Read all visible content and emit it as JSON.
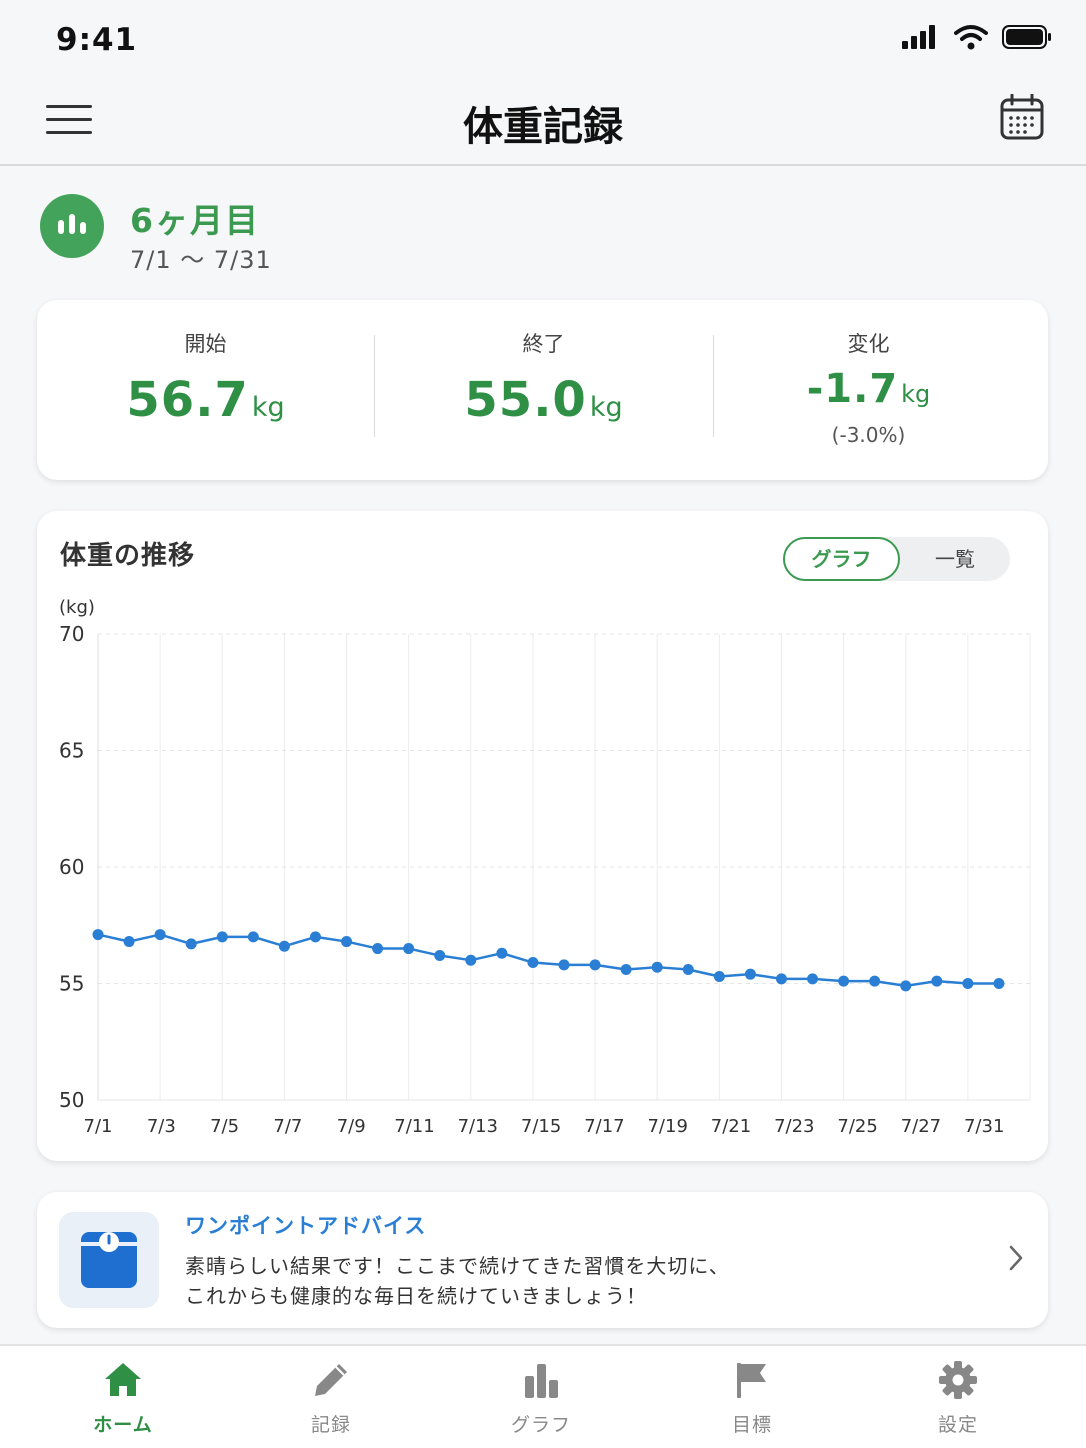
{
  "status_bar": {
    "time": "9:41"
  },
  "nav": {
    "title": "体重記録"
  },
  "period": {
    "title": "6ヶ月目",
    "range": "7/1 〜 7/31"
  },
  "summary": {
    "start": {
      "label": "開始",
      "value": "56.7",
      "unit": "kg"
    },
    "end": {
      "label": "終了",
      "value": "55.0",
      "unit": "kg"
    },
    "change": {
      "label": "変化",
      "value": "-1.7",
      "unit": "kg",
      "percent": "(-3.0%)"
    }
  },
  "chart_section": {
    "title": "体重の推移",
    "toggle_graph": "グラフ",
    "toggle_list": "一覧"
  },
  "chart_data": {
    "type": "line",
    "ylabel": "(kg)",
    "ylim": [
      50,
      70
    ],
    "yticks": [
      "70",
      "65",
      "60",
      "55",
      "50"
    ],
    "xtick_labels": [
      "7/1",
      "7/3",
      "7/5",
      "7/7",
      "7/9",
      "7/11",
      "7/13",
      "7/15",
      "7/17",
      "7/19",
      "7/21",
      "7/23",
      "7/25",
      "7/27",
      "7/31"
    ],
    "x": [
      "7/1",
      "7/2",
      "7/3",
      "7/4",
      "7/5",
      "7/6",
      "7/7",
      "7/8",
      "7/9",
      "7/10",
      "7/11",
      "7/12",
      "7/13",
      "7/14",
      "7/15",
      "7/16",
      "7/17",
      "7/18",
      "7/19",
      "7/20",
      "7/21",
      "7/22",
      "7/23",
      "7/24",
      "7/25",
      "7/26",
      "7/27",
      "7/28",
      "7/29",
      "7/30",
      "7/31"
    ],
    "series": [
      {
        "values": [
          57.1,
          56.8,
          57.1,
          56.7,
          57.0,
          57.0,
          56.6,
          57.0,
          56.8,
          56.5,
          56.5,
          56.2,
          56.0,
          56.3,
          55.9,
          55.8,
          55.8,
          55.6,
          55.7,
          55.6,
          55.3,
          55.4,
          55.2,
          55.2,
          55.1,
          55.1,
          54.9,
          55.1,
          55.0,
          55.0
        ],
        "color": "#2a7fd4"
      }
    ],
    "grid": true
  },
  "advice": {
    "title": "ワンポイントアドバイス",
    "line1": "素晴らしい結果です！ここまで続けてきた習慣を大切に、",
    "line2": "これからも健康的な毎日を続けていきましょう！"
  },
  "tabs": [
    {
      "label": "ホーム",
      "icon": "home-icon",
      "active": true
    },
    {
      "label": "記録",
      "icon": "pencil-icon",
      "active": false
    },
    {
      "label": "グラフ",
      "icon": "bar-chart-icon",
      "active": false
    },
    {
      "label": "目標",
      "icon": "flag-icon",
      "active": false
    },
    {
      "label": "設定",
      "icon": "gear-icon",
      "active": false
    }
  ],
  "colors": {
    "accent_green": "#3b9a50",
    "value_green": "#2e8f45",
    "line_blue": "#2a7fd4",
    "background": "#f6f7f8"
  }
}
